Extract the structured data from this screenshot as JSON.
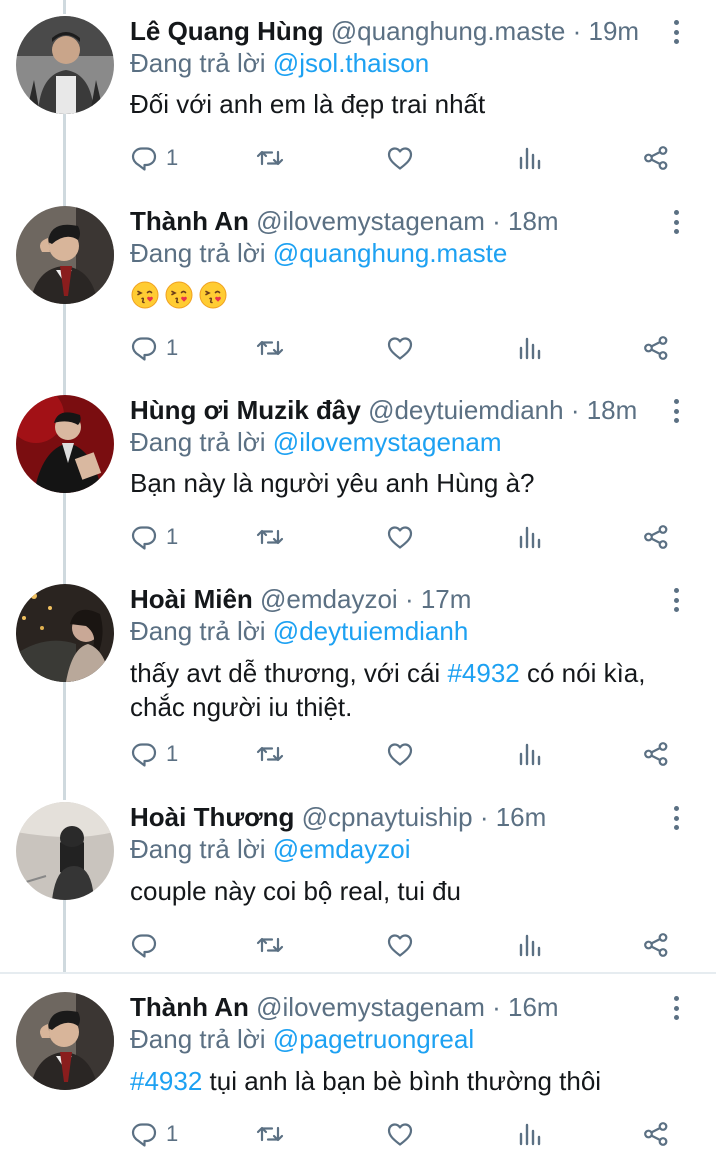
{
  "replying_prefix": "Đang trả lời",
  "tweets": [
    {
      "name": "Lê Quang Hùng",
      "handle": "@quanghung.maste",
      "dot": "·",
      "time": "19m",
      "reply_to": "@jsol.thaison",
      "text": "Đối với anh em là đẹp trai nhất",
      "reply_count": "1"
    },
    {
      "name": "Thành An",
      "handle": "@ilovemystagenam",
      "dot": "·",
      "time": "18m",
      "reply_to": "@quanghung.maste",
      "emojis": [
        "face-blowing-kiss-icon",
        "face-blowing-kiss-icon",
        "face-blowing-kiss-icon"
      ],
      "reply_count": "1"
    },
    {
      "name": "Hùng ơi Muzik đây",
      "handle": "@deytuiemdianh",
      "dot": "·",
      "time": "18m",
      "reply_to": "@ilovemystagenam",
      "text": "Bạn này là người yêu anh Hùng à?",
      "reply_count": "1"
    },
    {
      "name": "Hoài Miên",
      "handle": "@emdayzoi",
      "dot": "·",
      "time": "17m",
      "reply_to": "@deytuiemdianh",
      "text_before": "thấy avt dễ thương, với cái ",
      "hashtag": "#4932",
      "text_after": " có nói kìa,",
      "text_line2": "chắc người iu thiệt.",
      "reply_count": "1"
    },
    {
      "name": "Hoài Thương",
      "handle": "@cpnaytuiship",
      "dot": "·",
      "time": "16m",
      "reply_to": "@emdayzoi",
      "text": "couple này coi bộ real, tui đu",
      "reply_count": ""
    },
    {
      "name": "Thành An",
      "handle": "@ilovemystagenam",
      "dot": "·",
      "time": "16m",
      "reply_to": "@pagetruongreal",
      "hashtag": "#4932",
      "text_after": " tụi anh là bạn bè bình thường thôi",
      "reply_count": "1"
    }
  ],
  "icons": {
    "reply": "reply-icon",
    "retweet": "retweet-icon",
    "like": "heart-icon",
    "stats": "analytics-icon",
    "share": "share-icon",
    "more": "more-vertical-icon"
  },
  "colors": {
    "text": "#14171a",
    "muted": "#5b7083",
    "link": "#1da1f2",
    "thread_line": "#cfd9de",
    "divider": "#e6ecf0"
  }
}
